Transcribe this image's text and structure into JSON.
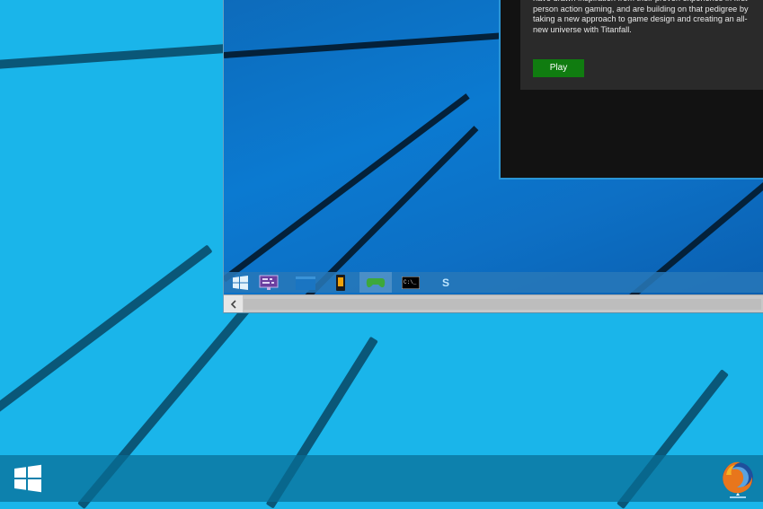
{
  "store": {
    "description": "have drawn inspiration from their proven experience in first-person action gaming, and are building on that pedigree by taking a new approach to game design and creating an all-new universe with Titanfall.",
    "play_label": "Play"
  },
  "vm_taskbar": {
    "items": [
      {
        "name": "start",
        "icon": "windows-logo"
      },
      {
        "name": "remote-desktop",
        "icon": "monitor-icon"
      },
      {
        "name": "file-explorer",
        "icon": "folder-icon"
      },
      {
        "name": "phone",
        "icon": "phone-icon"
      },
      {
        "name": "xbox",
        "icon": "gamepad-icon",
        "active": true
      },
      {
        "name": "command-prompt",
        "icon": "cmd-icon",
        "text": "C:\\_"
      },
      {
        "name": "skype",
        "icon": "skype-icon",
        "text": "S"
      }
    ]
  },
  "host_taskbar": {
    "start": "windows-logo",
    "pinned": [
      "firefox-icon"
    ]
  },
  "colors": {
    "desktop": "#1ab5ea",
    "play_button": "#107c10",
    "accent": "#2a95d6"
  }
}
